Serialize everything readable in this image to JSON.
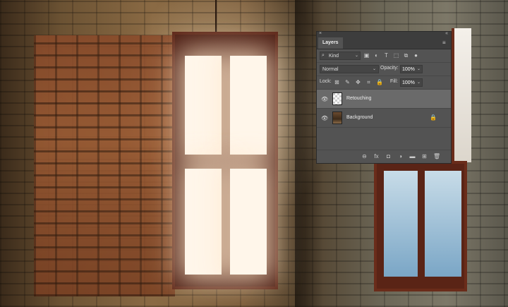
{
  "panel": {
    "title": "Layers",
    "close_glyph": "×",
    "collapse_glyph": "«",
    "menu_glyph": "≡"
  },
  "filter": {
    "search_glyph": "⌕",
    "kind_label": "Kind",
    "caret_glyph": "⌄",
    "icons": [
      "image-filter-icon",
      "adjustment-filter-icon",
      "type-filter-icon",
      "shape-filter-icon",
      "smart-object-filter-icon",
      "filter-toggle-icon"
    ],
    "icon_glyphs": [
      "▣",
      "◐",
      "T",
      "⬚",
      "⧉",
      "●"
    ]
  },
  "blend": {
    "mode": "Normal",
    "caret_glyph": "⌄",
    "opacity_label": "Opacity:",
    "opacity_value": "100%"
  },
  "lock": {
    "label": "Lock:",
    "icons": [
      "lock-transparent-pixels-icon",
      "lock-image-pixels-icon",
      "lock-position-icon",
      "prevent-auto-nesting-icon",
      "lock-all-icon"
    ],
    "icon_glyphs": [
      "⊠",
      "✎",
      "✥",
      "⌗",
      "🔒"
    ],
    "fill_label": "Fill:",
    "fill_value": "100%"
  },
  "layers": [
    {
      "name": "Retouching",
      "selected": true,
      "eye_glyph": "👁"
    },
    {
      "name": "Background",
      "selected": false,
      "eye_glyph": "👁",
      "lock_glyph": "🔒"
    }
  ],
  "footer": {
    "icons": [
      "link-layers-icon",
      "fx-icon",
      "add-mask-icon",
      "adjustment-layer-icon",
      "new-group-icon",
      "new-layer-icon",
      "delete-layer-icon"
    ],
    "icon_glyphs": [
      "⊖",
      "fx",
      "◘",
      "◑",
      "▬",
      "⊞",
      "🗑"
    ]
  },
  "colors": {
    "panel_bg": "#535353",
    "panel_header": "#3d3d3d",
    "selected_row": "#6a6a6a"
  }
}
